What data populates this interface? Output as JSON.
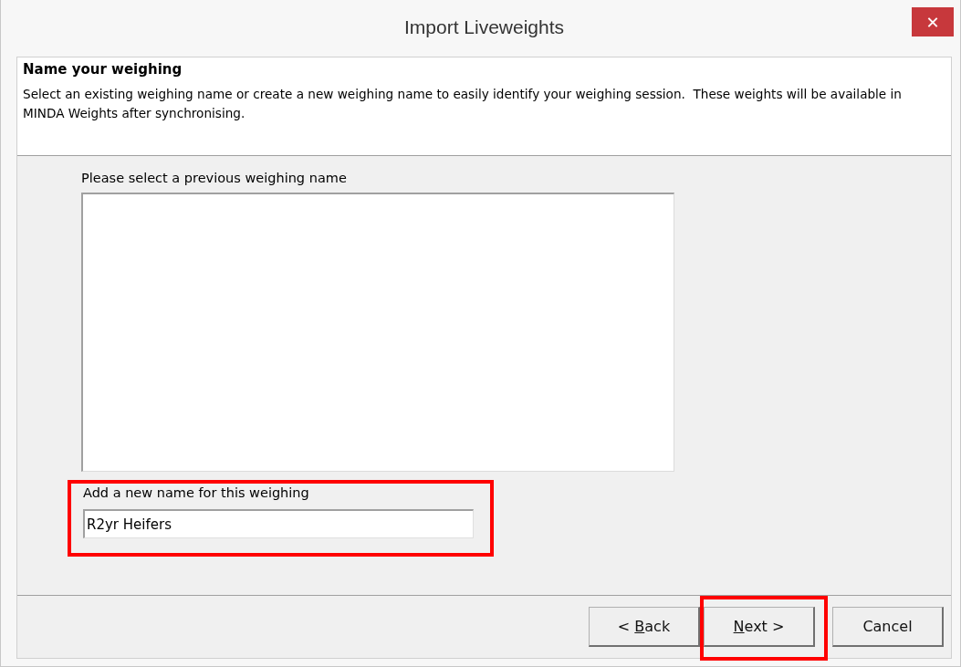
{
  "window": {
    "title": "Import Liveweights",
    "close": "✕"
  },
  "header": {
    "title": "Name your weighing",
    "description": "Select an existing weighing name or create a new weighing name to easily identify your weighing session.  These weights will be available in MINDA Weights after synchronising."
  },
  "previous_names": {
    "label": "Please select a previous weighing name"
  },
  "new_name": {
    "label": "Add a new name for this weighing",
    "value": "R2yr Heifers",
    "highlighted": true
  },
  "buttons": [
    {
      "label": {
        "before": "< ",
        "underlined": "B",
        "after": "ack"
      },
      "highlighted": false
    },
    {
      "label": {
        "underlined": "N",
        "after": "ext >"
      },
      "highlighted": true
    },
    {
      "label": {
        "before": "Cancel"
      },
      "highlighted": false
    }
  ]
}
